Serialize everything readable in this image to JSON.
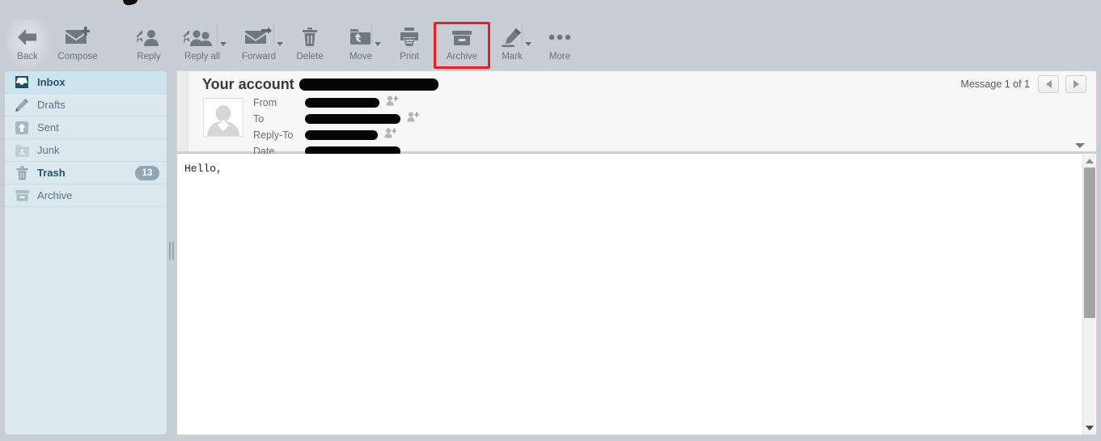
{
  "app": {
    "accent_highlight_color": "#ee1b24",
    "toolbar_bg": "#c7ced5",
    "sidebar_bg": "#dbe9ef"
  },
  "toolbar": {
    "items": [
      {
        "label": "Back",
        "icon": "back-arrow-icon",
        "has_dropdown": false,
        "highlighted": false,
        "active": true
      },
      {
        "label": "Compose",
        "icon": "compose-mail-icon",
        "has_dropdown": false,
        "highlighted": false,
        "active": false
      },
      {
        "label": "Reply",
        "icon": "reply-icon",
        "has_dropdown": false,
        "highlighted": false,
        "active": false
      },
      {
        "label": "Reply all",
        "icon": "reply-all-icon",
        "has_dropdown": true,
        "highlighted": false,
        "active": false
      },
      {
        "label": "Forward",
        "icon": "forward-mail-icon",
        "has_dropdown": true,
        "highlighted": false,
        "active": false
      },
      {
        "label": "Delete",
        "icon": "trash-icon",
        "has_dropdown": false,
        "highlighted": false,
        "active": false
      },
      {
        "label": "Move",
        "icon": "folder-move-icon",
        "has_dropdown": true,
        "highlighted": false,
        "active": false
      },
      {
        "label": "Print",
        "icon": "printer-icon",
        "has_dropdown": false,
        "highlighted": false,
        "active": false
      },
      {
        "label": "Archive",
        "icon": "archive-box-icon",
        "has_dropdown": false,
        "highlighted": true,
        "active": false
      },
      {
        "label": "Mark",
        "icon": "marker-pen-icon",
        "has_dropdown": true,
        "highlighted": false,
        "active": false
      },
      {
        "label": "More",
        "icon": "ellipsis-icon",
        "has_dropdown": false,
        "highlighted": false,
        "active": false
      }
    ]
  },
  "sidebar": {
    "folders": [
      {
        "label": "Inbox",
        "icon": "inbox-icon",
        "selected": true,
        "bold": true,
        "badge": null
      },
      {
        "label": "Drafts",
        "icon": "pencil-icon",
        "selected": false,
        "bold": false,
        "badge": null
      },
      {
        "label": "Sent",
        "icon": "sent-icon",
        "selected": false,
        "bold": false,
        "badge": null
      },
      {
        "label": "Junk",
        "icon": "junk-icon",
        "selected": false,
        "bold": false,
        "badge": null
      },
      {
        "label": "Trash",
        "icon": "trash-icon",
        "selected": false,
        "bold": true,
        "badge": "13"
      },
      {
        "label": "Archive",
        "icon": "archive-icon",
        "selected": false,
        "bold": false,
        "badge": null
      }
    ]
  },
  "message": {
    "subject_prefix": "Your account",
    "subject_redacted": true,
    "headers": [
      {
        "key": "From",
        "value": "",
        "redacted": true,
        "redaction_width": 92,
        "add_contact": true
      },
      {
        "key": "To",
        "value": "",
        "redacted": true,
        "redaction_width": 118,
        "add_contact": true
      },
      {
        "key": "Reply-To",
        "value": "",
        "redacted": true,
        "redaction_width": 90,
        "add_contact": true
      },
      {
        "key": "Date",
        "value": "",
        "redacted": true,
        "redaction_width": 118,
        "add_contact": false
      }
    ],
    "counter": "Message 1 of 1",
    "prev_label": "Previous message",
    "next_label": "Next message",
    "expand_label": "Show message details",
    "body": "Hello,"
  }
}
